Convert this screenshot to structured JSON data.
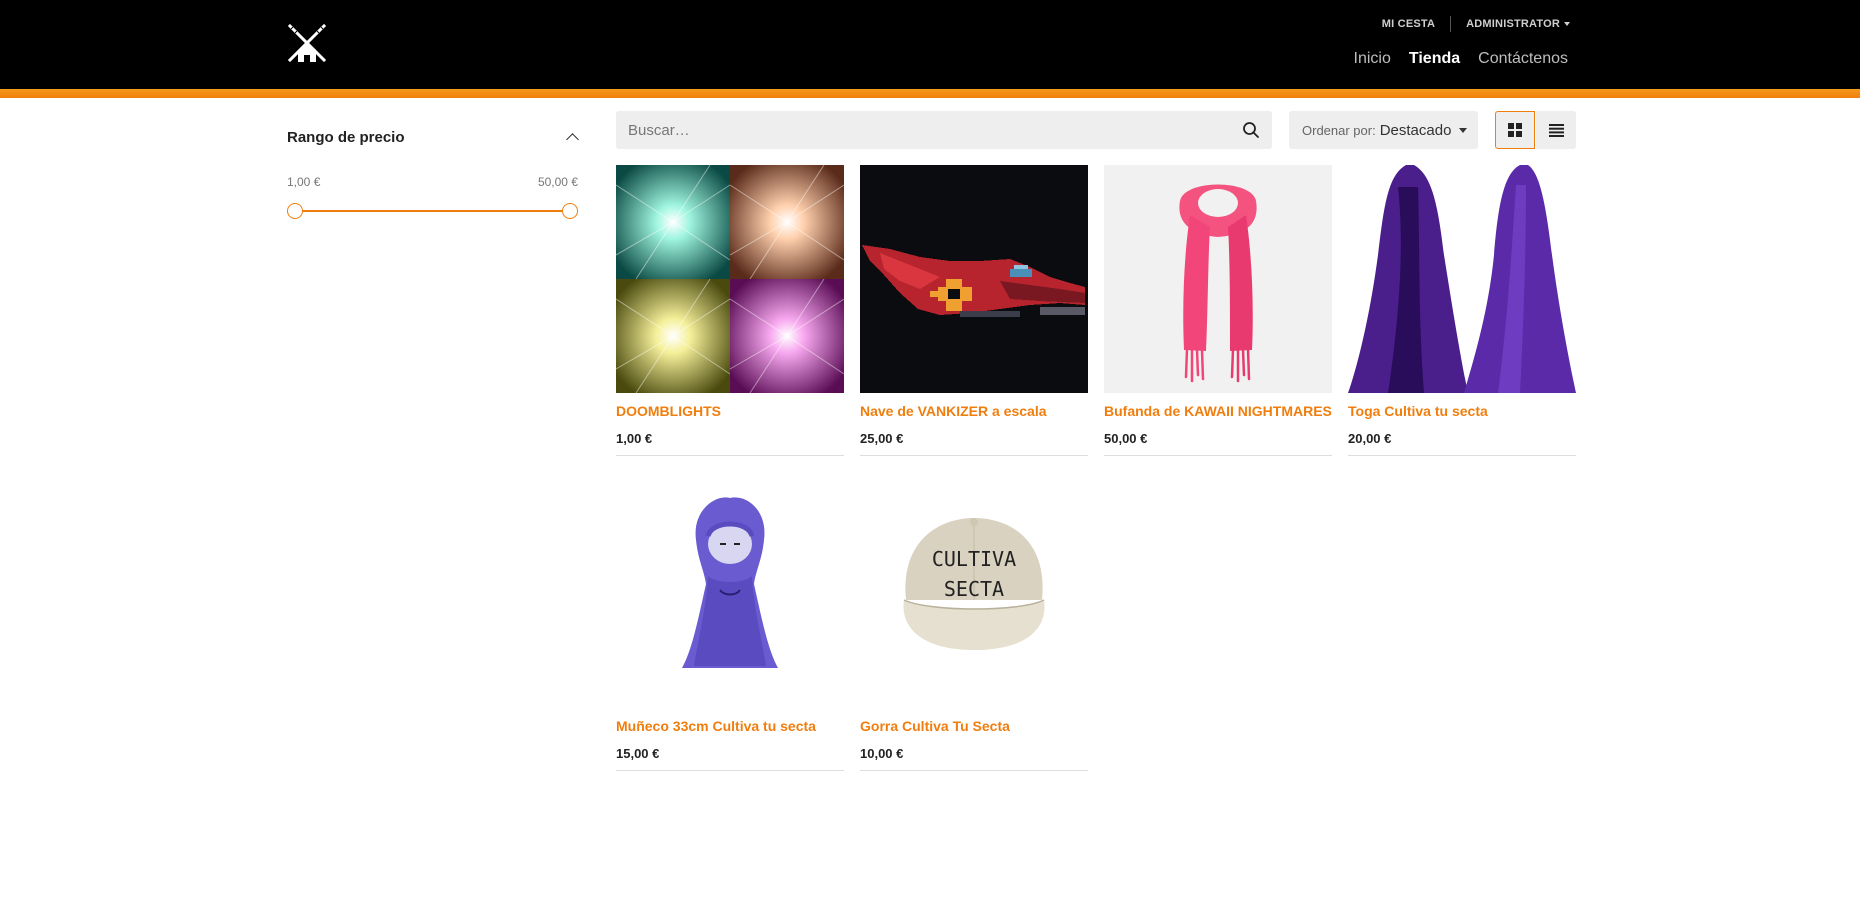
{
  "header": {
    "util_links": [
      "MI CESTA",
      "ADMINISTRATOR"
    ],
    "nav": [
      {
        "label": "Inicio",
        "active": false
      },
      {
        "label": "Tienda",
        "active": true
      },
      {
        "label": "Contáctenos",
        "active": false
      }
    ],
    "accent_color": "#f07e0e"
  },
  "sidebar": {
    "filter_title": "Rango de precio",
    "min_label": "1,00 €",
    "max_label": "50,00 €"
  },
  "toolbar": {
    "search_placeholder": "Buscar…",
    "sort_prefix": "Ordenar por:",
    "sort_value": "Destacado",
    "view_mode": "grid"
  },
  "products": [
    {
      "name": "DOOMBLIGHTS",
      "price": "1,00 €",
      "image": "four-light-burst-tiles"
    },
    {
      "name": "Nave de VANKIZER a escala",
      "price": "25,00 €",
      "image": "pixel-red-spaceship"
    },
    {
      "name": "Bufanda de KAWAII NIGHTMARES",
      "price": "50,00 €",
      "image": "pink-scarf"
    },
    {
      "name": "Toga Cultiva tu secta",
      "price": "20,00 €",
      "image": "purple-hooded-robes"
    },
    {
      "name": "Muñeco 33cm Cultiva tu secta",
      "price": "15,00 €",
      "image": "purple-hooded-plush"
    },
    {
      "name": "Gorra Cultiva Tu Secta",
      "price": "10,00 €",
      "image": "beige-cap",
      "image_text": [
        "CULTIVA",
        "SECTA"
      ]
    }
  ]
}
